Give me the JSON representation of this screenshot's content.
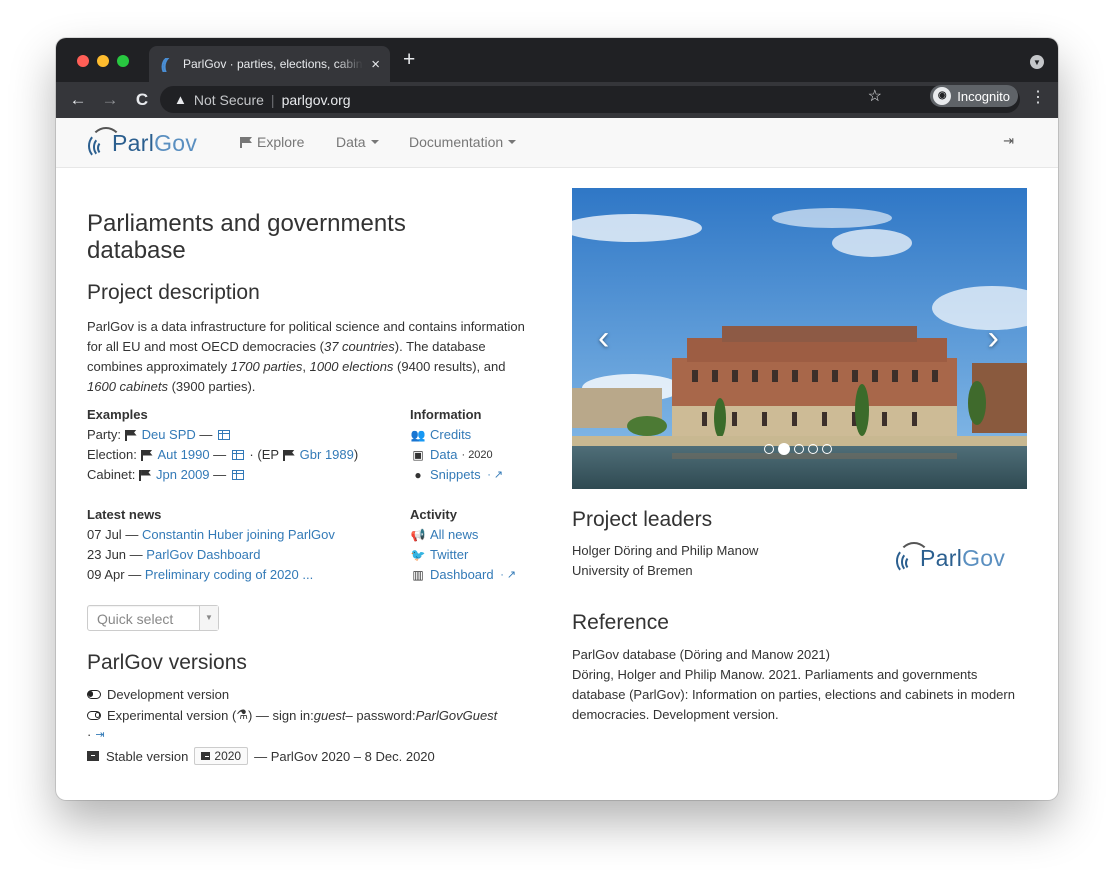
{
  "browser": {
    "tab_title": "ParlGov · parties, elections, cabinets",
    "tab_favicon": "((",
    "close_glyph": "×",
    "new_tab_glyph": "+",
    "back_glyph": "←",
    "forward_glyph": "→",
    "reload_glyph": "C",
    "warning_glyph": "▲",
    "security_text": "Not Secure",
    "separator": "|",
    "url": "parlgov.org",
    "star_glyph": "☆",
    "incognito_label": "Incognito",
    "menu_glyph": "⋮",
    "colors": {
      "tabbar": "#202124",
      "toolbar": "#35363a"
    }
  },
  "nav": {
    "logo_prefix": "Parl",
    "logo_suffix": "Gov",
    "explore": "Explore",
    "data": "Data",
    "documentation": "Documentation",
    "signin_icon": "sign-in-icon"
  },
  "left": {
    "title": "Parliaments and governments database",
    "project_description_heading": "Project description",
    "description": {
      "p1": "ParlGov is a data infrastructure for political science and contains information for all EU and most OECD democracies (",
      "countries": "37 countries",
      "p2": "). The database combines approximately ",
      "parties": "1700 parties",
      "p3": ", ",
      "elections": "1000 elections",
      "p4": " (9400 results), and ",
      "cabinets": "1600 cabinets",
      "p5": " (3900 parties)."
    },
    "examples": {
      "heading": "Examples",
      "party_label": "Party:",
      "party_link": "Deu SPD",
      "election_label": "Election:",
      "election_link": "Aut 1990",
      "ep_prefix": "· (EP",
      "ep_link": "Gbr 1989",
      "ep_suffix": ")",
      "cabinet_label": "Cabinet:",
      "cabinet_link": "Jpn 2009",
      "dash": "—"
    },
    "information": {
      "heading": "Information",
      "credits": "Credits",
      "data": "Data",
      "data_year": "· 2020",
      "snippets": "Snippets",
      "ext_separator": "·"
    },
    "latest_news": {
      "heading": "Latest news",
      "items": [
        {
          "date": "07 Jul",
          "title": "Constantin Huber joining ParlGov"
        },
        {
          "date": "23 Jun",
          "title": "ParlGov Dashboard"
        },
        {
          "date": "09 Apr",
          "title": "Preliminary coding of 2020 ..."
        }
      ],
      "dash": "—"
    },
    "activity": {
      "heading": "Activity",
      "all_news": "All news",
      "twitter": "Twitter",
      "dashboard": "Dashboard"
    },
    "quick_select": {
      "placeholder": "Quick select",
      "arrow": "▼"
    },
    "versions": {
      "heading": "ParlGov versions",
      "development": "Development version",
      "experimental_prefix": "Experimental version (",
      "experimental_suffix": ") — sign in: ",
      "user": "guest",
      "password_label": " – password: ",
      "password": "ParlGovGuest",
      "dot": "·",
      "stable": "Stable version",
      "stable_badge": "2020",
      "stable_suffix": "— ParlGov 2020 – 8 Dec. 2020"
    }
  },
  "right": {
    "carousel": {
      "prev_glyph": "‹",
      "next_glyph": "›",
      "slide_count": 5,
      "active_slide": 2
    },
    "project_leaders_heading": "Project leaders",
    "leaders": "Holger Döring and Philip Manow",
    "university": "University of Bremen",
    "logo_prefix": "Parl",
    "logo_suffix": "Gov",
    "reference_heading": "Reference",
    "reference_short": "ParlGov database (Döring and Manow 2021)",
    "reference_full": "Döring, Holger and Philip Manow. 2021. Parliaments and governments database (ParlGov): Information on parties, elections and cabinets in modern democracies. Development version."
  }
}
